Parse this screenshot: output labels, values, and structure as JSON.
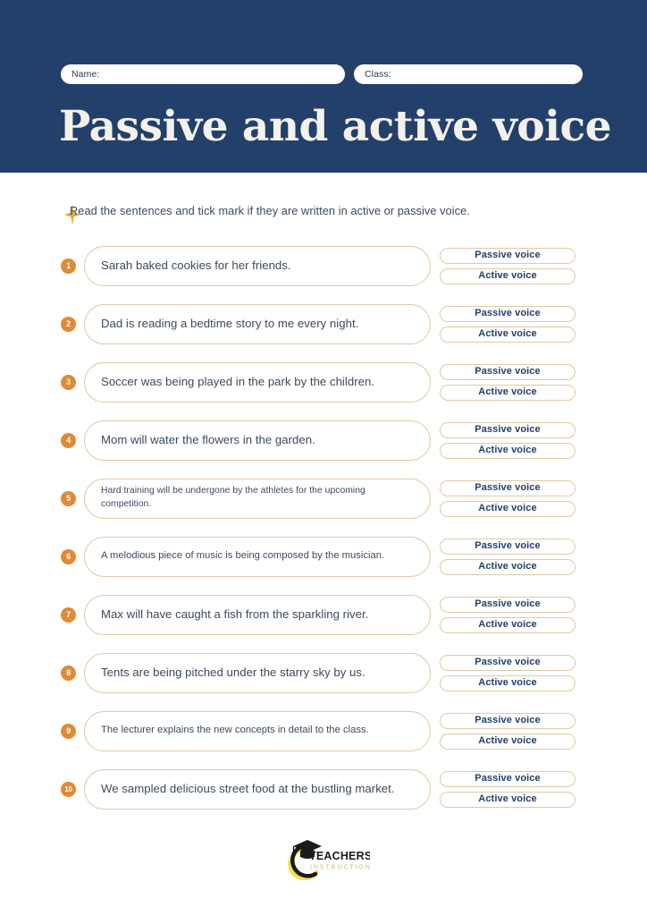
{
  "header": {
    "title": "Passive and active voice",
    "fields": [
      {
        "label": "Name:",
        "value": ""
      },
      {
        "label": "Class:",
        "value": ""
      }
    ],
    "background_color": "#23406b",
    "title_color": "#f4f1ec"
  },
  "instruction": {
    "icon": "sparkle-icon",
    "text": "Read the sentences and tick mark if they are written in active or passive voice."
  },
  "options": {
    "passive_label": "Passive voice",
    "active_label": "Active voice",
    "border_color": "#e0c9a6",
    "text_color": "#23406b"
  },
  "questions": [
    {
      "number": "1",
      "sentence": "Sarah baked cookies for her friends.",
      "size": "md"
    },
    {
      "number": "2",
      "sentence": "Dad is reading a bedtime story to me every night.",
      "size": "md"
    },
    {
      "number": "3",
      "sentence": "Soccer was being played in the park by the children.",
      "size": "md"
    },
    {
      "number": "4",
      "sentence": "Mom will water the flowers in the garden.",
      "size": "md"
    },
    {
      "number": "5",
      "sentence": "Hard training will be undergone by the athletes for the upcoming competition.",
      "size": "xs"
    },
    {
      "number": "6",
      "sentence": "A melodious piece of music is being composed by the musician.",
      "size": "sm"
    },
    {
      "number": "7",
      "sentence": "Max will have caught a fish from the sparkling river.",
      "size": "md"
    },
    {
      "number": "8",
      "sentence": "Tents are being pitched under the starry sky by us.",
      "size": "md"
    },
    {
      "number": "9",
      "sentence": "The lecturer explains the new concepts in detail to the class.",
      "size": "sm"
    },
    {
      "number": "10",
      "sentence": "We sampled delicious street food at the bustling market.",
      "size": "md"
    }
  ],
  "badge": {
    "background_color": "#e08a37",
    "text_color": "#ffffff"
  },
  "footer": {
    "logo_primary": "TEACHERS",
    "logo_secondary": "INSTRUCTION",
    "accent_color": "#f2e14c"
  }
}
